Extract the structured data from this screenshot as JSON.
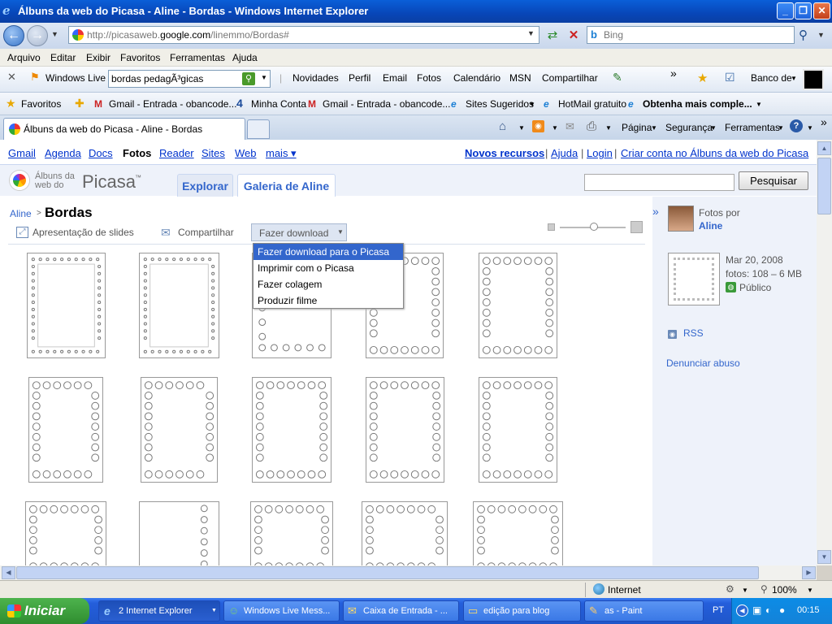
{
  "window": {
    "title": "Álbuns da web do Picasa - Aline - Bordas - Windows Internet Explorer"
  },
  "address": {
    "url_prefix": "http://picasaweb.",
    "url_domain": "google.com",
    "url_path": "/linemmo/Bordas#",
    "search_placeholder": "Bing"
  },
  "menu": [
    "Arquivo",
    "Editar",
    "Exibir",
    "Favoritos",
    "Ferramentas",
    "Ajuda"
  ],
  "linksbar": {
    "windows_live": "Windows Live",
    "search_value": "bordas pedagÃ³gicas",
    "items": [
      "Novidades",
      "Perfil",
      "Email",
      "Fotos",
      "Calendário",
      "MSN",
      "Compartilhar"
    ],
    "banco": "Banco de"
  },
  "favbar": {
    "favoritos": "Favoritos",
    "items": [
      "Gmail - Entrada - obancode...",
      "Minha Conta",
      "Gmail - Entrada - obancode...",
      "Sites Sugeridos",
      "HotMail gratuito",
      "Obtenha mais comple..."
    ]
  },
  "tabbar": {
    "tab_title": "Álbuns da web do Picasa - Aline - Bordas",
    "tools": [
      "Página",
      "Segurança",
      "Ferramentas"
    ]
  },
  "google_bar": {
    "left": [
      "Gmail",
      "Agenda",
      "Docs",
      "Fotos",
      "Reader",
      "Sites",
      "Web",
      "mais ▾"
    ],
    "right": [
      "Novos recursos",
      "Ajuda",
      "Login",
      "Criar conta no Álbuns da web do Picasa"
    ]
  },
  "picasa": {
    "logo_small1": "Álbuns da",
    "logo_small2": "web do",
    "logo_big": "Picasa",
    "tm": "™",
    "tabs": [
      "Explorar",
      "Galeria de Aline"
    ],
    "search_button": "Pesquisar",
    "breadcrumb_user": "Aline",
    "breadcrumb_sep": ">",
    "album_title": "Bordas",
    "actions": {
      "slideshow": "Apresentação de slides",
      "share": "Compartilhar",
      "download": "Fazer download"
    },
    "dropdown": [
      "Fazer download para o Picasa",
      "Imprimir com o Picasa",
      "Fazer colagem",
      "Produzir filme"
    ],
    "sidebar": {
      "photos_by": "Fotos por",
      "owner": "Aline",
      "date": "Mar 20, 2008",
      "stats": "fotos: 108 – 6 MB",
      "visibility": "Público",
      "rss": "RSS",
      "report": "Denunciar abuso"
    }
  },
  "status": {
    "zone": "Internet",
    "zoom": "100%"
  },
  "taskbar": {
    "start": "Iniciar",
    "tasks": [
      "2 Internet Explorer",
      "Windows Live Mess...",
      "Caixa de Entrada - ...",
      "edição para blog",
      "as - Paint"
    ],
    "lang": "PT",
    "clock": "00:15"
  },
  "colors": {
    "title_bar": "#0846b8",
    "link": "#0033cc",
    "picasa_tab_text": "#3366cc",
    "dropdown_highlight": "#3366cc"
  }
}
